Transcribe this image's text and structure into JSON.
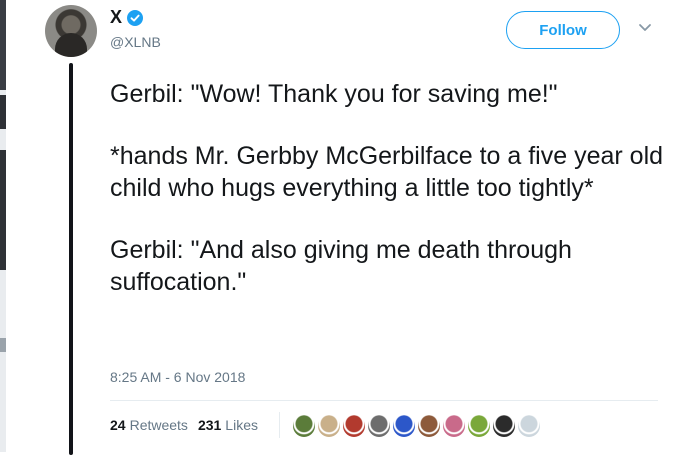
{
  "tweet": {
    "author": {
      "display_name": "X",
      "handle": "@XLNB",
      "verified": true
    },
    "follow_label": "Follow",
    "paragraphs": [
      "Gerbil: \"Wow! Thank you for saving me!\"",
      "*hands Mr. Gerbby McGerbilface to a five year old child who hugs everything a little too tightly*",
      "Gerbil: \"And also giving me death through suffocation.\""
    ],
    "timestamp": "8:25 AM - 6 Nov 2018",
    "stats": {
      "retweets_count": "24",
      "retweets_label": "Retweets",
      "likes_count": "231",
      "likes_label": "Likes"
    },
    "liker_avatars": [
      "#5b7c3a",
      "#c9b08a",
      "#b23a2e",
      "#6d6d6d",
      "#2c57c9",
      "#8d5a3b",
      "#c96a8a",
      "#7aa83a",
      "#2b2b2b",
      "#ccd6dd"
    ]
  },
  "colors": {
    "accent": "#1da1f2",
    "text": "#14171a",
    "secondary": "#657786"
  }
}
